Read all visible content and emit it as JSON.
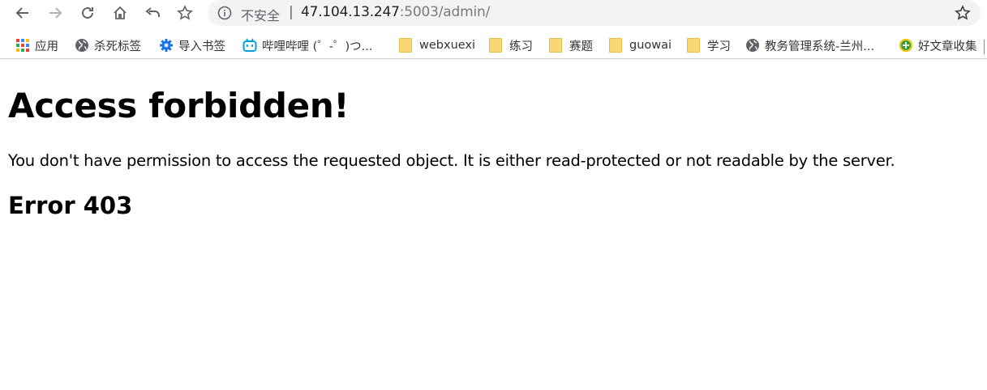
{
  "omnibox": {
    "security_label": "不安全",
    "separator": "|",
    "url_host": "47.104.13.247",
    "url_rest": ":5003/admin/"
  },
  "bookmarks": [
    {
      "label": "应用",
      "icon": "apps-grid-icon"
    },
    {
      "label": "杀死标签",
      "icon": "globe-icon"
    },
    {
      "label": "导入书签",
      "icon": "gear-icon"
    },
    {
      "label": "哔哩哔哩 (゜-゜)つ...",
      "icon": "bilibili-icon"
    },
    {
      "label": "webxuexi",
      "icon": "folder-icon"
    },
    {
      "label": "练习",
      "icon": "folder-icon"
    },
    {
      "label": "赛题",
      "icon": "folder-icon"
    },
    {
      "label": "guowai",
      "icon": "folder-icon"
    },
    {
      "label": "学习",
      "icon": "folder-icon"
    },
    {
      "label": "教务管理系统-兰州...",
      "icon": "globe-icon"
    },
    {
      "label": "好文章收集",
      "icon": "plus-badge-icon"
    }
  ],
  "page": {
    "title": "Access forbidden!",
    "message": "You don't have permission to access the requested object. It is either read-protected or not readable by the server.",
    "error": "Error 403"
  },
  "colors": {
    "omnibox_bg": "#f1f3f4",
    "folder": "#f8d774",
    "gear": "#1a73e8",
    "bilibili": "#00a1d6"
  }
}
